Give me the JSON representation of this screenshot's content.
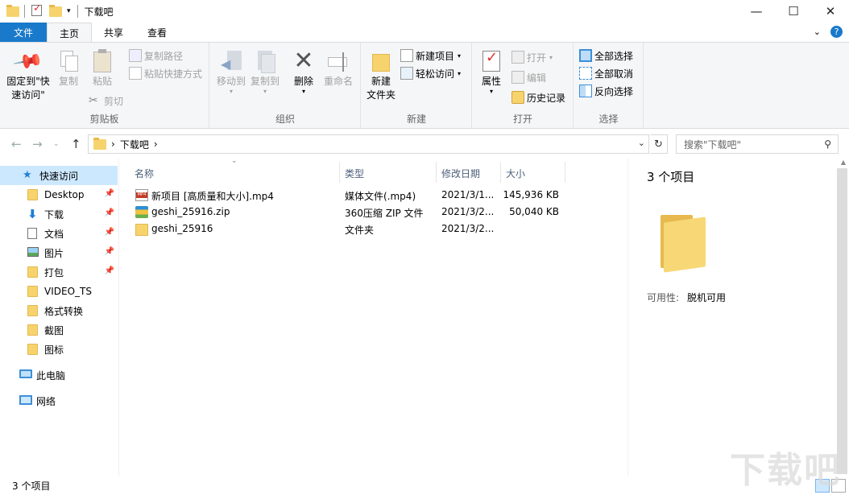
{
  "window": {
    "title": "下载吧",
    "controls": {
      "minimize": "—",
      "maximize": "☐",
      "close": "✕"
    }
  },
  "ribbon_tabs": {
    "file": "文件",
    "home": "主页",
    "share": "共享",
    "view": "查看"
  },
  "ribbon": {
    "clipboard": {
      "label": "剪贴板",
      "pin_quick_access": "固定到\"快\n速访问\"",
      "copy": "复制",
      "paste": "粘贴",
      "copy_path": "复制路径",
      "paste_shortcut": "粘贴快捷方式",
      "cut": "剪切"
    },
    "organize": {
      "label": "组织",
      "move_to": "移动到",
      "copy_to": "复制到",
      "delete": "删除",
      "rename": "重命名"
    },
    "new": {
      "label": "新建",
      "new_folder": "新建\n文件夹",
      "new_item": "新建项目",
      "easy_access": "轻松访问"
    },
    "open": {
      "label": "打开",
      "properties": "属性",
      "open": "打开",
      "edit": "编辑",
      "history": "历史记录"
    },
    "select": {
      "label": "选择",
      "select_all": "全部选择",
      "select_none": "全部取消",
      "invert": "反向选择"
    }
  },
  "address": {
    "path": "下载吧",
    "search_placeholder": "搜索\"下载吧\""
  },
  "nav": {
    "quick_access": "快速访问",
    "items": [
      "Desktop",
      "下载",
      "文档",
      "图片",
      "打包",
      "VIDEO_TS",
      "格式转换",
      "截图",
      "图标"
    ],
    "this_pc": "此电脑",
    "network": "网络"
  },
  "columns": {
    "name": "名称",
    "type": "类型",
    "modified": "修改日期",
    "size": "大小"
  },
  "files": [
    {
      "name": "新项目 [高质量和大小].mp4",
      "type": "媒体文件(.mp4)",
      "modified": "2021/3/1...",
      "size": "145,936 KB"
    },
    {
      "name": "geshi_25916.zip",
      "type": "360压缩 ZIP 文件",
      "modified": "2021/3/2...",
      "size": "50,040 KB"
    },
    {
      "name": "geshi_25916",
      "type": "文件夹",
      "modified": "2021/3/2...",
      "size": ""
    }
  ],
  "preview": {
    "count": "3 个项目",
    "availability_label": "可用性:",
    "availability_value": "脱机可用"
  },
  "status": {
    "count": "3 个项目"
  },
  "watermark": "下载吧"
}
